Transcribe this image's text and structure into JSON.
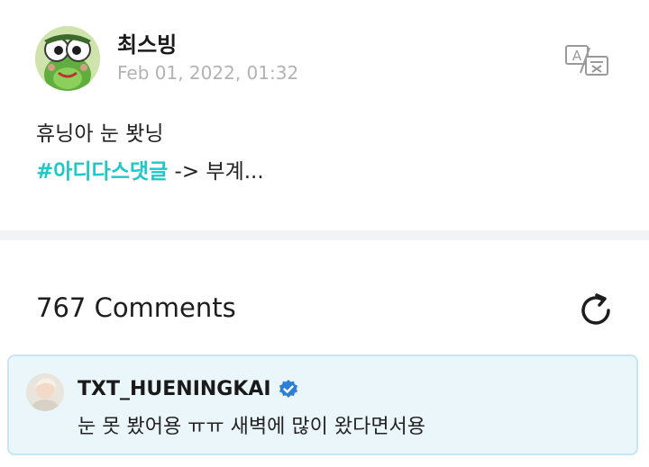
{
  "post": {
    "author_name": "최스빙",
    "date": "Feb 01, 2022, 01:32",
    "body_line1": "휴닝아 눈 봣닝",
    "hashtag": "#아디다스댓글",
    "body_rest": " -> 부계...",
    "translate_icon": "translate-icon"
  },
  "comments": {
    "count_label": "767 Comments",
    "refresh_icon": "refresh-icon",
    "highlighted": {
      "author": "TXT_HUENINGKAI",
      "verified_icon": "verified-badge-icon",
      "text": "눈 못 봤어용 ㅠㅠ 새벽에 많이 왔다면서용"
    }
  },
  "colors": {
    "hashtag": "#1fc7c6",
    "date": "#b3b3b3",
    "verified": "#2d7fd6",
    "comment_bg": "#ebf6fb",
    "comment_border": "#c6e6f3",
    "divider": "#f2f3f5"
  }
}
